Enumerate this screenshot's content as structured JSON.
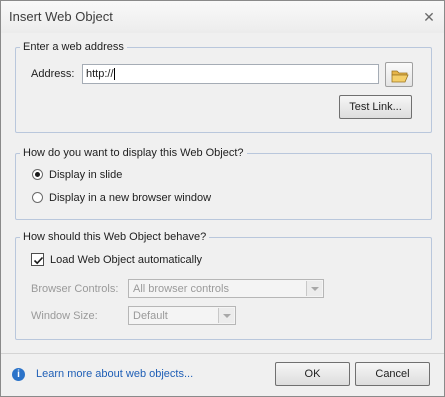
{
  "window": {
    "title": "Insert Web Object",
    "close_glyph": "✕"
  },
  "address_group": {
    "legend": "Enter a web address",
    "address_label": "Address:",
    "address_value": "http://",
    "browse_icon": "folder-open-icon",
    "test_link_label": "Test Link..."
  },
  "display_group": {
    "legend": "How do you want to display this Web Object?",
    "options": [
      {
        "label": "Display in slide",
        "selected": true
      },
      {
        "label": "Display in a new browser window",
        "selected": false
      }
    ]
  },
  "behave_group": {
    "legend": "How should this Web Object behave?",
    "load_auto_label": "Load Web Object automatically",
    "load_auto_checked": true,
    "browser_controls_label": "Browser Controls:",
    "browser_controls_value": "All browser controls",
    "window_size_label": "Window Size:",
    "window_size_value": "Default"
  },
  "footer": {
    "info_glyph": "i",
    "learn_more_link": "Learn more about web objects...",
    "ok_label": "OK",
    "cancel_label": "Cancel"
  },
  "colors": {
    "accent": "#2b73c9",
    "link": "#1f5fb6",
    "group_border": "#b9c7dc"
  }
}
